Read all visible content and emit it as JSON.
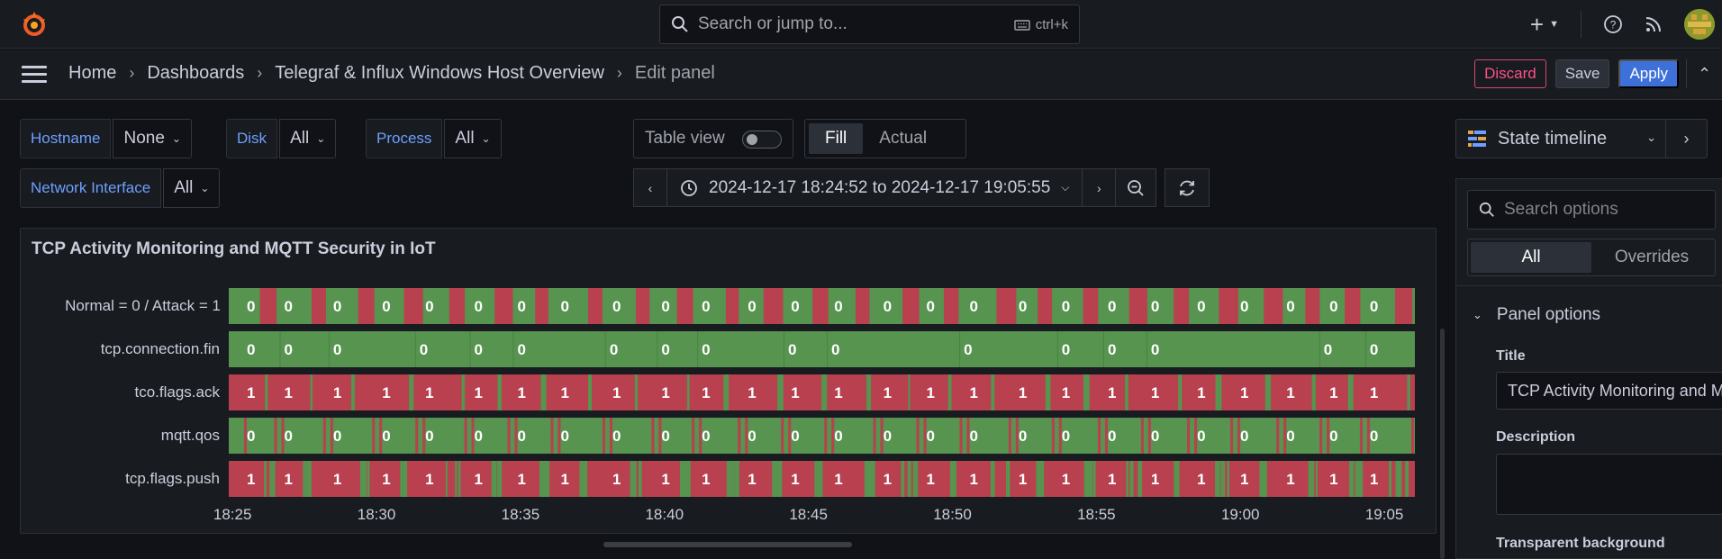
{
  "topbar": {
    "search_placeholder": "Search or jump to...",
    "search_shortcut": "ctrl+k",
    "icons": [
      "grafana-logo",
      "plus-icon",
      "help-icon",
      "news-rss-icon",
      "user-avatar"
    ]
  },
  "breadcrumb": {
    "items": [
      "Home",
      "Dashboards",
      "Telegraf & Influx Windows Host Overview"
    ],
    "current": "Edit panel"
  },
  "actions": {
    "discard": "Discard",
    "save": "Save",
    "apply": "Apply"
  },
  "variables": [
    {
      "label": "Hostname",
      "value": "None"
    },
    {
      "label": "Disk",
      "value": "All"
    },
    {
      "label": "Process",
      "value": "All"
    },
    {
      "label": "Network Interface",
      "value": "All"
    }
  ],
  "view": {
    "table_view_label": "Table view",
    "table_view_on": false,
    "fill_options": [
      "Fill",
      "Actual"
    ],
    "fill_selected": "Fill"
  },
  "time_range": {
    "text": "2024-12-17 18:24:52 to 2024-12-17 19:05:55"
  },
  "options_pane": {
    "visualization": "State timeline",
    "search_placeholder": "Search options",
    "tabs": [
      "All",
      "Overrides"
    ],
    "active_tab": "All",
    "section": "Panel options",
    "title_label": "Title",
    "title_value": "TCP Activity Monitoring and MQTT Security in IoT",
    "description_label": "Description",
    "transparent_label": "Transparent background"
  },
  "colors": {
    "state_0": "#56944f",
    "state_1": "#b8404f",
    "accent": "#3d71d9",
    "discard": "#ff5286"
  },
  "panel": {
    "title": "TCP Activity Monitoring and MQTT Security in IoT"
  },
  "chart_data": {
    "type": "state-timeline",
    "title": "TCP Activity Monitoring and MQTT Security in IoT",
    "x_ticks": [
      "18:25",
      "18:30",
      "18:35",
      "18:40",
      "18:45",
      "18:50",
      "18:55",
      "19:00",
      "19:05"
    ],
    "rows": [
      {
        "name": "Normal = 0 / Attack = 1",
        "display_label": "Normal = 0 / Attack = 1",
        "label_value": "0"
      },
      {
        "name": "tcp.connection.fin",
        "display_label": "tcp.connection.fin",
        "label_value": "0"
      },
      {
        "name": "tco.flags.ack",
        "display_label": "tco.flags.ack",
        "label_value": "1"
      },
      {
        "name": "mqtt.qos",
        "display_label": "mqtt.qos",
        "label_value": "0"
      },
      {
        "name": "tcp.flags.push",
        "display_label": "tcp.flags.push",
        "label_value": "1"
      }
    ],
    "label_positions_minutes": [
      0.4,
      1.7,
      3.4,
      5.1,
      6.6,
      8.3,
      9.8,
      11.3,
      13.1,
      14.8,
      16.2,
      17.8,
      19.3,
      20.8,
      22.5,
      24.0,
      25.5,
      27.2,
      28.7,
      30.3,
      31.8,
      33.4,
      34.9,
      36.5,
      38.0,
      39.4
    ],
    "fin_label_positions_minutes": [
      0.4,
      1.7,
      3.4,
      6.4,
      8.3,
      9.8,
      13.0,
      14.8,
      16.2,
      19.2,
      20.7,
      25.3,
      28.7,
      30.3,
      31.8,
      37.8,
      39.4
    ],
    "range_minutes": [
      -0.13,
      41.06
    ]
  }
}
